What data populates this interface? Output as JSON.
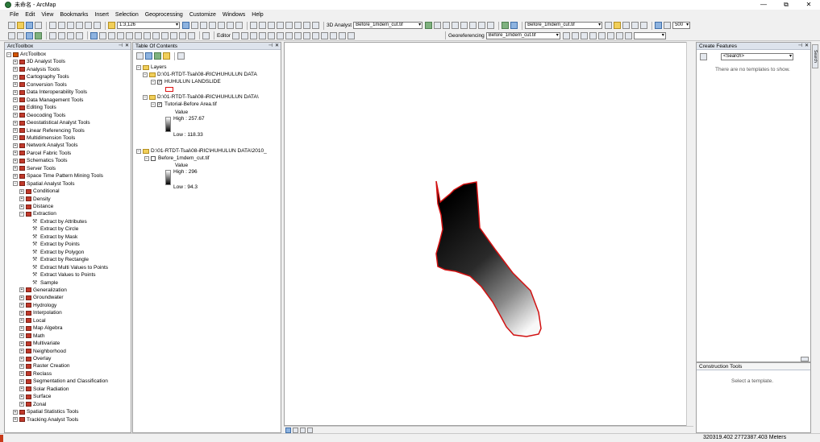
{
  "window": {
    "title": "未命名 - ArcMap",
    "controls": [
      "—",
      "⧉",
      "✕"
    ]
  },
  "menu": [
    "File",
    "Edit",
    "View",
    "Bookmarks",
    "Insert",
    "Selection",
    "Geoprocessing",
    "Customize",
    "Windows",
    "Help"
  ],
  "toolbar1": {
    "scale": "1:3,126",
    "analyst3d_label": "3D Analyst",
    "layer_combo_1": "Before_1mdem_cut.tif",
    "layer_combo_2": "Before_1mdem_cut.tif",
    "resolution": "500"
  },
  "toolbar2": {
    "editor_label": "Editor",
    "georef_label": "Georeferencing",
    "georef_combo": "Before_1mdem_cut.tif"
  },
  "toolbox": {
    "title": "ArcToolbox",
    "root": "ArcToolbox",
    "items": [
      "3D Analyst Tools",
      "Analysis Tools",
      "Cartography Tools",
      "Conversion Tools",
      "Data Interoperability Tools",
      "Data Management Tools",
      "Editing Tools",
      "Geocoding Tools",
      "Geostatistical Analyst Tools",
      "Linear Referencing Tools",
      "Multidimension Tools",
      "Network Analyst Tools",
      "Parcel Fabric Tools",
      "Schematics Tools",
      "Server Tools",
      "Space Time Pattern Mining Tools",
      "Spatial Analyst Tools"
    ],
    "spatial_children": [
      "Conditional",
      "Density",
      "Distance",
      "Extraction"
    ],
    "extraction_tools": [
      "Extract by Attributes",
      "Extract by Circle",
      "Extract by Mask",
      "Extract by Points",
      "Extract by Polygon",
      "Extract by Rectangle",
      "Extract Multi Values to Points",
      "Extract Values to Points",
      "Sample"
    ],
    "spatial_rest": [
      "Generalization",
      "Groundwater",
      "Hydrology",
      "Interpolation",
      "Local",
      "Map Algebra",
      "Math",
      "Multivariate",
      "Neighborhood",
      "Overlay",
      "Raster Creation",
      "Reclass",
      "Segmentation and Classification",
      "Solar Radiation",
      "Surface",
      "Zonal"
    ],
    "tail": [
      "Spatial Statistics Tools",
      "Tracking Analyst Tools"
    ]
  },
  "toc": {
    "title": "Table Of Contents",
    "layers_label": "Layers",
    "group1_path": "D:\\01-RTDT-Tsai\\08-iRIC\\HUHULUN DATA",
    "group1_layer": "HUHULUN LANDSLIDE",
    "group2_path": "D:\\01-RTDT-Tsai\\08-iRIC\\HUHULUN DATA\\",
    "group2_layer": "Tutorial-Before Area.tif",
    "group2_value": "Value",
    "group2_high": "High : 257.67",
    "group2_low": "Low : 118.33",
    "group3_path": "D:\\01-RTDT-Tsai\\08-iRIC\\HUHULUN DATA\\2010_",
    "group3_layer": "Before_1mdem_cut.tif",
    "group3_value": "Value",
    "group3_high": "High : 296",
    "group3_low": "Low : 94.3"
  },
  "create_features": {
    "title": "Create Features",
    "search_placeholder": "<Search>",
    "empty_message": "There are no templates to show."
  },
  "construction": {
    "title": "Construction Tools",
    "message": "Select a template."
  },
  "status": {
    "coords": "320319.402  2772387.403 Meters"
  },
  "side_tab": "Search",
  "colors": {
    "landslide_outline": "#d11111",
    "ramp_high": "#ffffff",
    "ramp_low": "#000000"
  }
}
